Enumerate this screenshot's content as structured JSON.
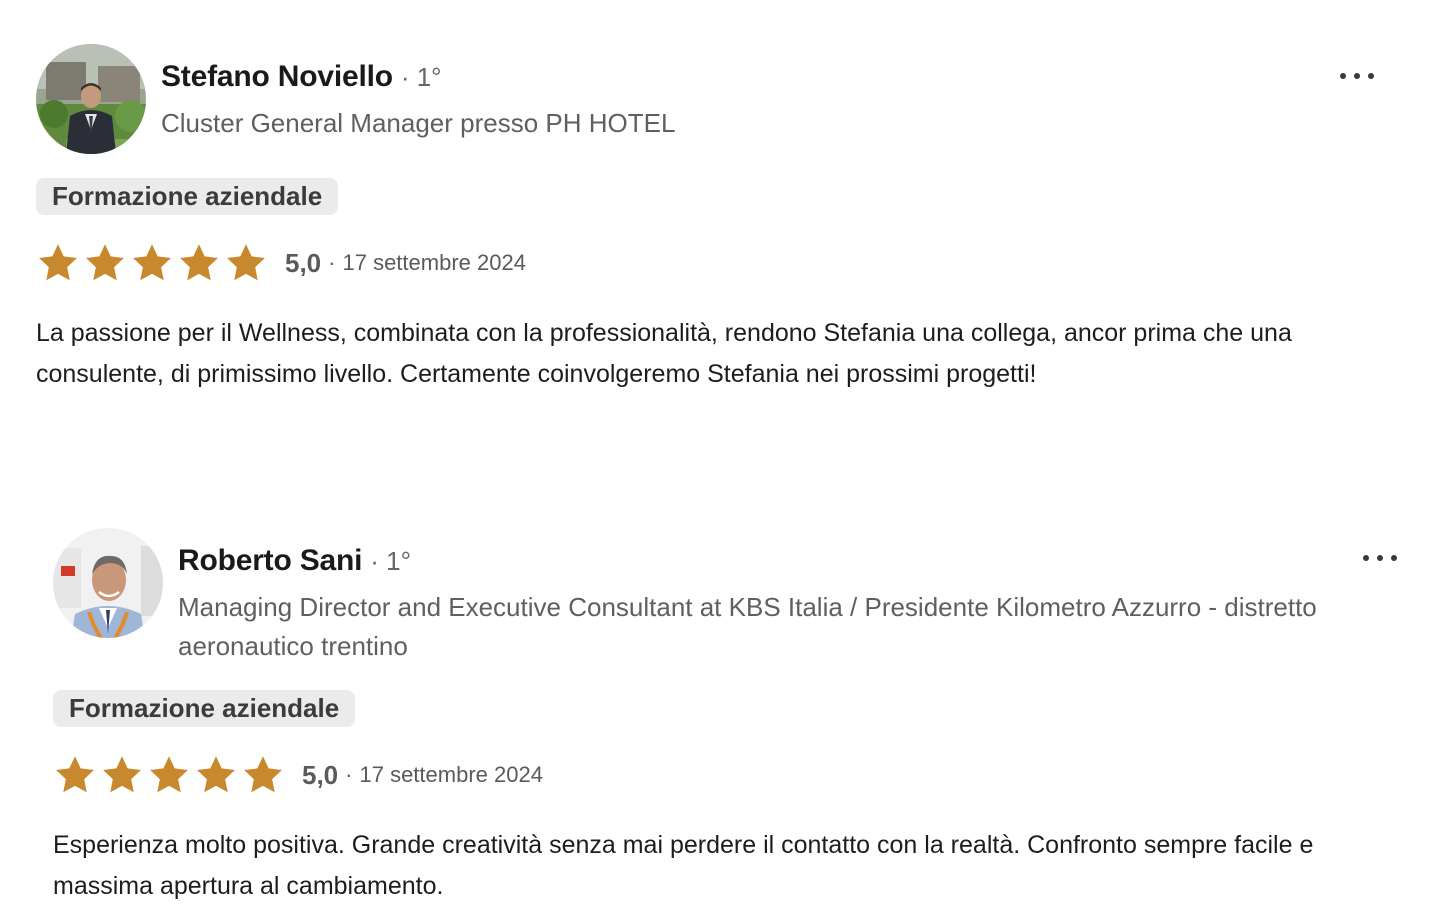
{
  "reviews": [
    {
      "name": "Stefano Noviello",
      "degree": "· 1°",
      "headline": "Cluster General Manager presso PH HOTEL",
      "service_tag": "Formazione aziendale",
      "rating": 5.0,
      "rating_label": "5,0",
      "separator": "·",
      "date": "17 settembre 2024",
      "text": "La passione per il Wellness, combinata con la professionalità, rendono Stefania una collega, ancor prima che una consulente, di primissimo livello. Certamente coinvolgeremo Stefania nei prossimi progetti!",
      "avatar_icon": "profile-photo",
      "more_icon": "more-options-icon"
    },
    {
      "name": "Roberto Sani",
      "degree": "· 1°",
      "headline": "Managing Director and Executive Consultant at KBS Italia / Presidente Kilometro Azzurro - distretto aeronautico trentino",
      "service_tag": "Formazione aziendale",
      "rating": 5.0,
      "rating_label": "5,0",
      "separator": "·",
      "date": "17 settembre 2024",
      "text": "Esperienza molto positiva. Grande creatività senza mai perdere il contatto con la realtà. Confronto sempre facile e massima apertura al cambiamento.",
      "avatar_icon": "profile-photo",
      "more_icon": "more-options-icon"
    }
  ],
  "colors": {
    "star": "#c8892e",
    "tag_background": "#ebebeb",
    "secondary_text": "#5f5f5f"
  }
}
